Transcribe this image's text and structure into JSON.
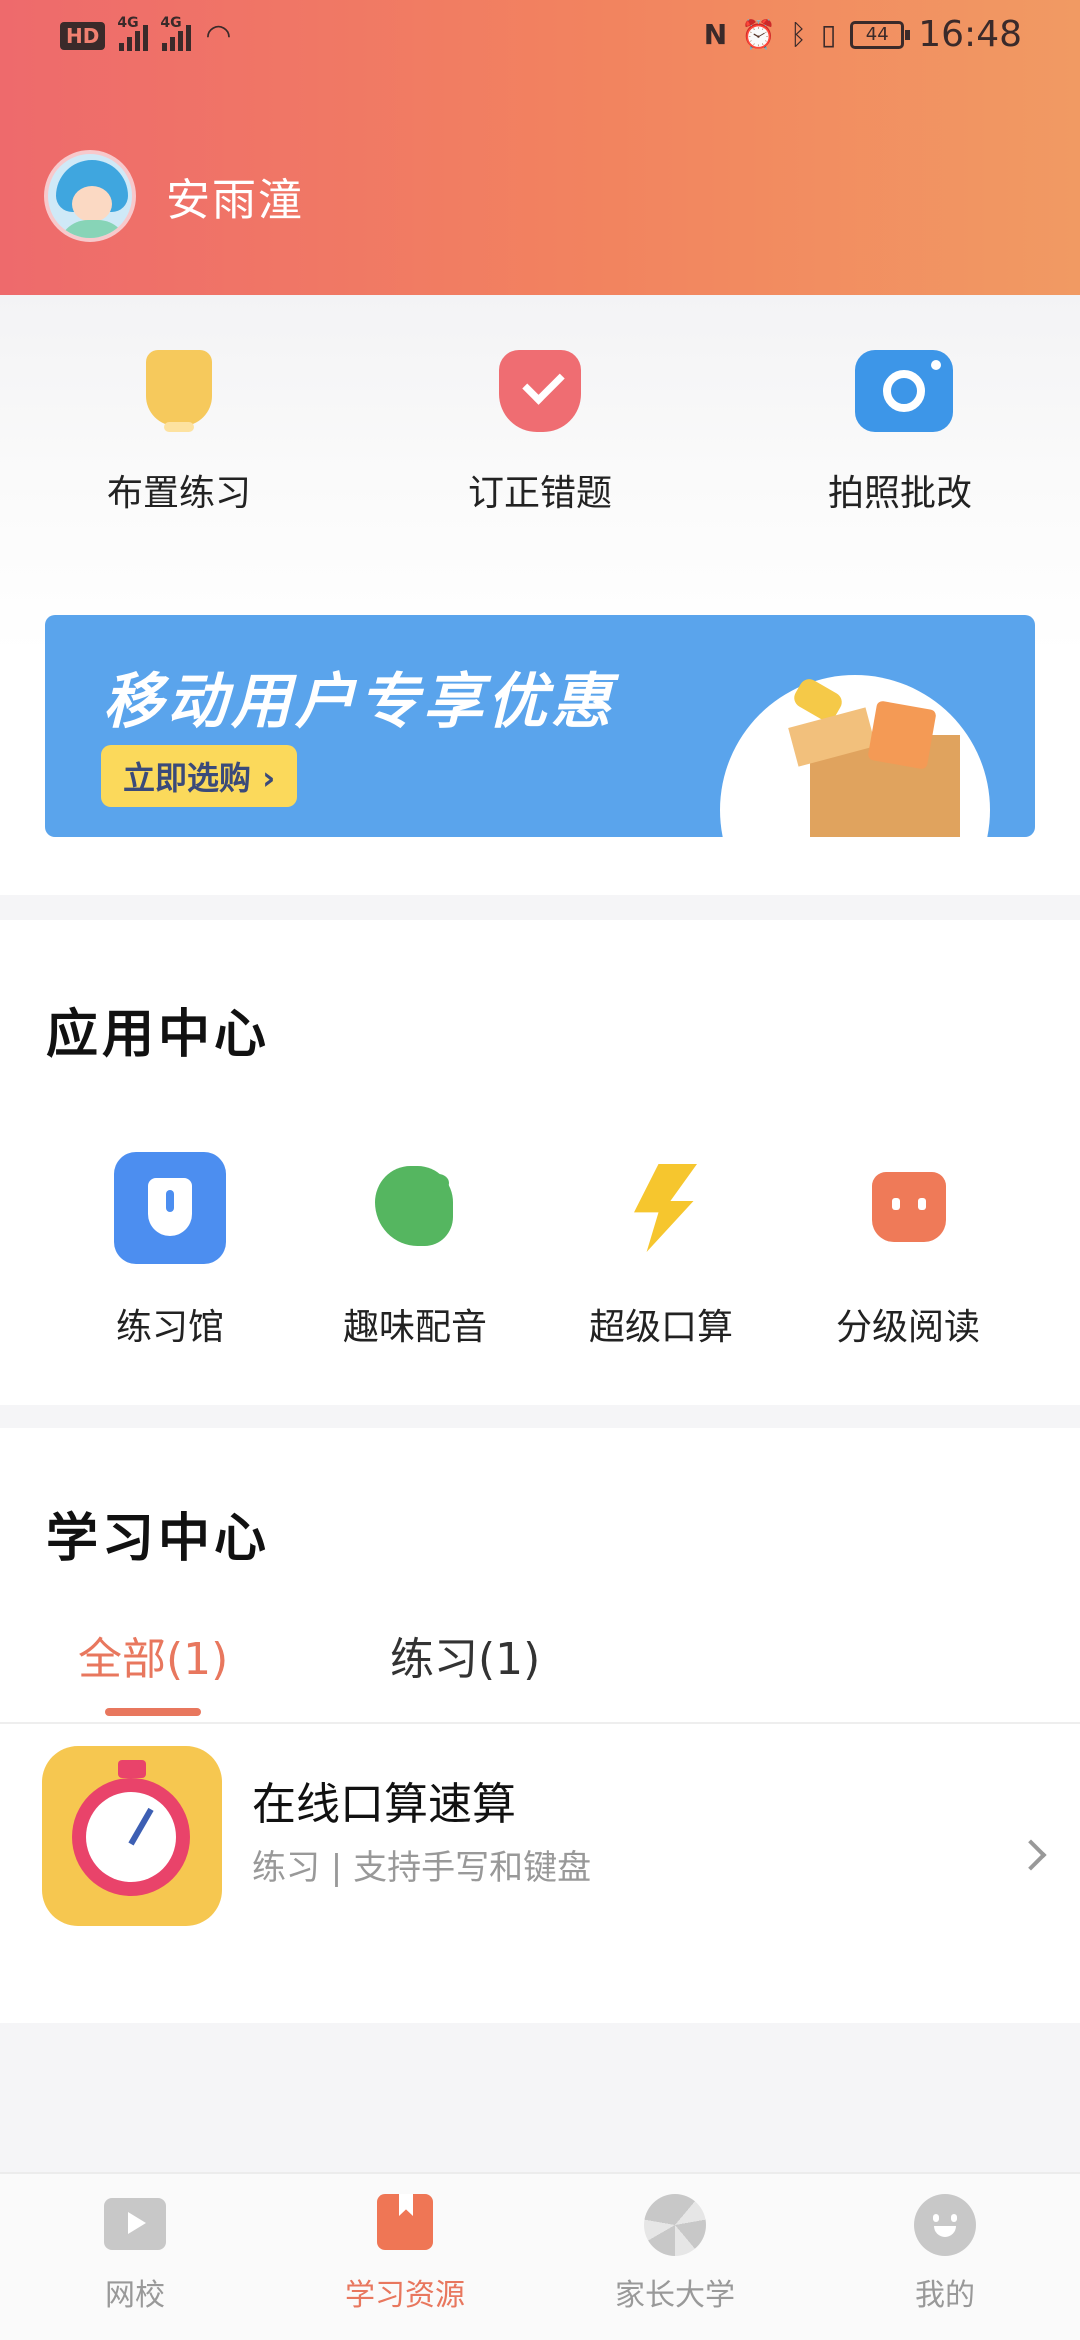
{
  "status_bar": {
    "left_badge": "HD",
    "network_1": "4G",
    "network_2": "4G",
    "battery": "44",
    "time": "16:48"
  },
  "profile": {
    "username": "安雨潼"
  },
  "quick_actions": [
    {
      "label": "布置练习",
      "icon": "lamp-icon"
    },
    {
      "label": "订正错题",
      "icon": "check-badge-icon"
    },
    {
      "label": "拍照批改",
      "icon": "camera-icon"
    }
  ],
  "banner": {
    "title": "移动用户专享优惠",
    "button_label": "立即选购 ›"
  },
  "app_center": {
    "title": "应用中心",
    "items": [
      {
        "label": "练习馆",
        "icon": "shield-icon"
      },
      {
        "label": "趣味配音",
        "icon": "bird-icon"
      },
      {
        "label": "超级口算",
        "icon": "lightning-icon"
      },
      {
        "label": "分级阅读",
        "icon": "fox-icon"
      }
    ]
  },
  "learning_center": {
    "title": "学习中心",
    "tabs": [
      {
        "label": "全部(1)",
        "active": true
      },
      {
        "label": "练习(1)",
        "active": false
      }
    ],
    "courses": [
      {
        "title": "在线口算速算",
        "subtitle": "练习 | 支持手写和键盘",
        "icon": "stopwatch-icon"
      }
    ]
  },
  "bottom_nav": [
    {
      "label": "网校",
      "icon": "video-icon",
      "active": false
    },
    {
      "label": "学习资源",
      "icon": "bookmark-icon",
      "active": true
    },
    {
      "label": "家长大学",
      "icon": "shutter-icon",
      "active": false
    },
    {
      "label": "我的",
      "icon": "smiley-icon",
      "active": false
    }
  ],
  "colors": {
    "header_start": "#ee6a6c",
    "header_end": "#f19a63",
    "accent": "#e8775e",
    "banner_bg": "#5aa4ec"
  }
}
